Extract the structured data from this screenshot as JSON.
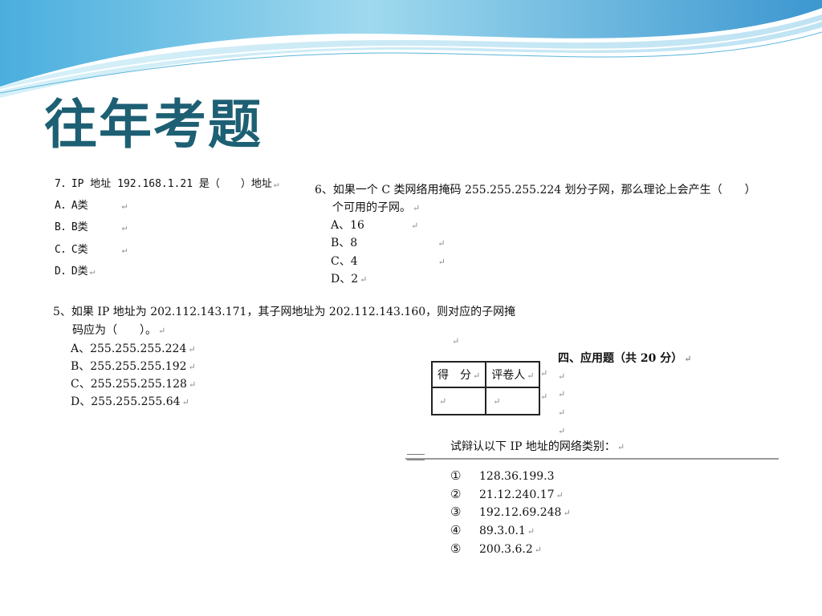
{
  "slide": {
    "title": "往年考题"
  },
  "return_mark": "↵",
  "q7": {
    "question": "7．IP 地址 192.168.1.21 是（　　）地址",
    "options": [
      "A．A类",
      "B．B类",
      "C．C类",
      "D．D类"
    ]
  },
  "q6": {
    "line1": "6、如果一个 C 类网络用掩码 255.255.255.224 划分子网，那么理论上会产生（　　）",
    "line2": "个可用的子网。",
    "options": [
      "A、16",
      "B、8",
      "C、4",
      "D、2"
    ]
  },
  "q5": {
    "line1": "5、如果 IP 地址为 202.112.143.171，其子网地址为 202.112.143.160，则对应的子网掩",
    "line2": "码应为（　　）。",
    "options": [
      "A、255.255.255.224",
      "B、255.255.255.192",
      "C、255.255.255.128",
      "D、255.255.255.64"
    ]
  },
  "part4": {
    "heading": "四、应用题（共 20 分）",
    "table": {
      "headers": [
        "得　分",
        "评卷人"
      ]
    },
    "instruction": "试辩认以下 IP 地址的网络类别：",
    "items": [
      {
        "marker": "①",
        "ip": "128.36.199.3"
      },
      {
        "marker": "②",
        "ip": "21.12.240.17"
      },
      {
        "marker": "③",
        "ip": "192.12.69.248"
      },
      {
        "marker": "④",
        "ip": "89.3.0.1"
      },
      {
        "marker": "⑤",
        "ip": "200.3.6.2"
      }
    ]
  },
  "colors": {
    "title": "#1d5f73",
    "wave_dark": "#3fa3d6",
    "wave_light": "#bfe6f4"
  }
}
